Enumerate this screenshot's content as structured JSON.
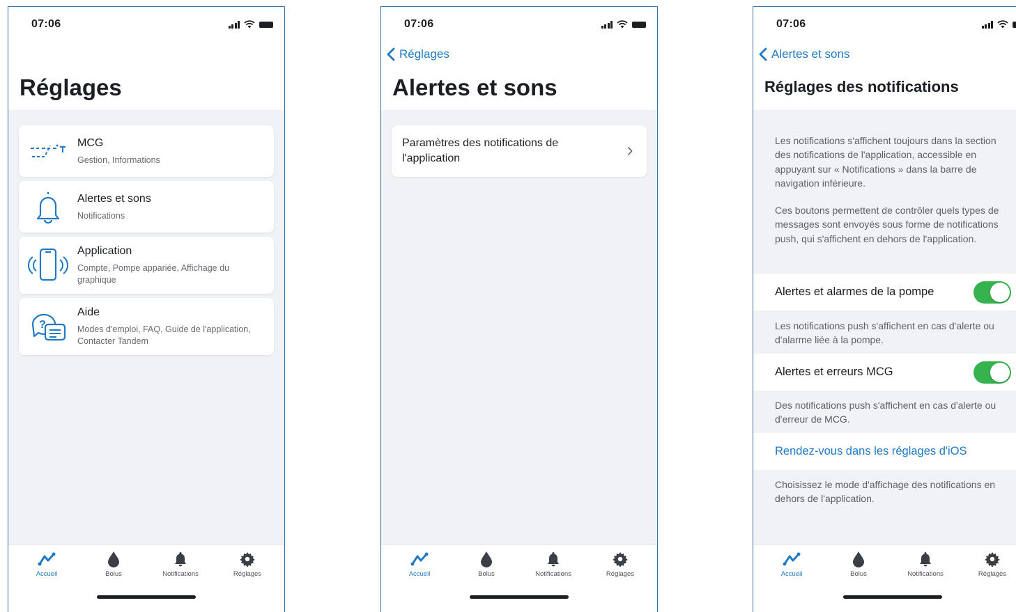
{
  "status": {
    "time": "07:06"
  },
  "tabs": [
    {
      "label": "Accueil",
      "icon": "trend-icon"
    },
    {
      "label": "Bolus",
      "icon": "drop-icon"
    },
    {
      "label": "Notifications",
      "icon": "bell-icon"
    },
    {
      "label": "Réglages",
      "icon": "gear-icon"
    }
  ],
  "screen1": {
    "title": "Réglages",
    "items": [
      {
        "title": "MCG",
        "subtitle": "Gestion, Informations",
        "icon": "cgm-trace-icon"
      },
      {
        "title": "Alertes et sons",
        "subtitle": "Notifications",
        "icon": "bell-outline-icon"
      },
      {
        "title": "Application",
        "subtitle": "Compte, Pompe appariée, Affichage du graphique",
        "icon": "phone-vibrate-icon"
      },
      {
        "title": "Aide",
        "subtitle": "Modes d'emploi, FAQ, Guide de l'application, Contacter Tandem",
        "icon": "help-chat-icon"
      }
    ]
  },
  "screen2": {
    "back": "Réglages",
    "title": "Alertes et sons",
    "item": "Paramètres des notifications de l'application"
  },
  "screen3": {
    "back": "Alertes et sons",
    "title": "Réglages des notifications",
    "intro1": "Les notifications s'affichent toujours dans la section des notifications de l'application, accessible en appuyant sur « Notifications » dans la barre de navigation inférieure.",
    "intro2": "Ces boutons permettent de contrôler quels types de messages sont envoyés sous forme de notifications push, qui s'affichent en dehors de l'application.",
    "toggle1": {
      "label": "Alertes et alarmes de la pompe",
      "on": true
    },
    "note1": "Les notifications push s'affichent en cas d'alerte ou d'alarme liée à la pompe.",
    "toggle2": {
      "label": "Alertes et erreurs MCG",
      "on": true
    },
    "note2": "Des notifications push s'affichent en cas d'alerte ou d'erreur de MCG.",
    "link": "Rendez-vous dans les réglages d'iOS",
    "note3": "Choisissez le mode d'affichage des notifications en dehors de l'application."
  },
  "colors": {
    "accent": "#1f79c4",
    "toggle_on": "#36b34f"
  }
}
